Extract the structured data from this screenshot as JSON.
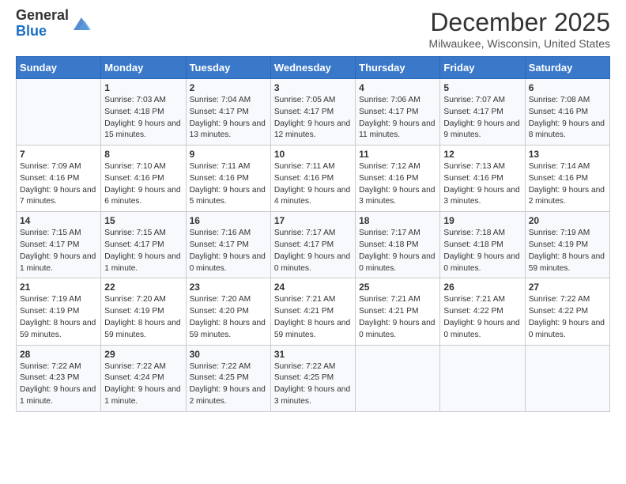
{
  "header": {
    "logo_general": "General",
    "logo_blue": "Blue",
    "month_title": "December 2025",
    "location": "Milwaukee, Wisconsin, United States"
  },
  "weekdays": [
    "Sunday",
    "Monday",
    "Tuesday",
    "Wednesday",
    "Thursday",
    "Friday",
    "Saturday"
  ],
  "weeks": [
    [
      {
        "day": "",
        "sunrise": "",
        "sunset": "",
        "daylight": ""
      },
      {
        "day": "1",
        "sunrise": "Sunrise: 7:03 AM",
        "sunset": "Sunset: 4:18 PM",
        "daylight": "Daylight: 9 hours and 15 minutes."
      },
      {
        "day": "2",
        "sunrise": "Sunrise: 7:04 AM",
        "sunset": "Sunset: 4:17 PM",
        "daylight": "Daylight: 9 hours and 13 minutes."
      },
      {
        "day": "3",
        "sunrise": "Sunrise: 7:05 AM",
        "sunset": "Sunset: 4:17 PM",
        "daylight": "Daylight: 9 hours and 12 minutes."
      },
      {
        "day": "4",
        "sunrise": "Sunrise: 7:06 AM",
        "sunset": "Sunset: 4:17 PM",
        "daylight": "Daylight: 9 hours and 11 minutes."
      },
      {
        "day": "5",
        "sunrise": "Sunrise: 7:07 AM",
        "sunset": "Sunset: 4:17 PM",
        "daylight": "Daylight: 9 hours and 9 minutes."
      },
      {
        "day": "6",
        "sunrise": "Sunrise: 7:08 AM",
        "sunset": "Sunset: 4:16 PM",
        "daylight": "Daylight: 9 hours and 8 minutes."
      }
    ],
    [
      {
        "day": "7",
        "sunrise": "Sunrise: 7:09 AM",
        "sunset": "Sunset: 4:16 PM",
        "daylight": "Daylight: 9 hours and 7 minutes."
      },
      {
        "day": "8",
        "sunrise": "Sunrise: 7:10 AM",
        "sunset": "Sunset: 4:16 PM",
        "daylight": "Daylight: 9 hours and 6 minutes."
      },
      {
        "day": "9",
        "sunrise": "Sunrise: 7:11 AM",
        "sunset": "Sunset: 4:16 PM",
        "daylight": "Daylight: 9 hours and 5 minutes."
      },
      {
        "day": "10",
        "sunrise": "Sunrise: 7:11 AM",
        "sunset": "Sunset: 4:16 PM",
        "daylight": "Daylight: 9 hours and 4 minutes."
      },
      {
        "day": "11",
        "sunrise": "Sunrise: 7:12 AM",
        "sunset": "Sunset: 4:16 PM",
        "daylight": "Daylight: 9 hours and 3 minutes."
      },
      {
        "day": "12",
        "sunrise": "Sunrise: 7:13 AM",
        "sunset": "Sunset: 4:16 PM",
        "daylight": "Daylight: 9 hours and 3 minutes."
      },
      {
        "day": "13",
        "sunrise": "Sunrise: 7:14 AM",
        "sunset": "Sunset: 4:16 PM",
        "daylight": "Daylight: 9 hours and 2 minutes."
      }
    ],
    [
      {
        "day": "14",
        "sunrise": "Sunrise: 7:15 AM",
        "sunset": "Sunset: 4:17 PM",
        "daylight": "Daylight: 9 hours and 1 minute."
      },
      {
        "day": "15",
        "sunrise": "Sunrise: 7:15 AM",
        "sunset": "Sunset: 4:17 PM",
        "daylight": "Daylight: 9 hours and 1 minute."
      },
      {
        "day": "16",
        "sunrise": "Sunrise: 7:16 AM",
        "sunset": "Sunset: 4:17 PM",
        "daylight": "Daylight: 9 hours and 0 minutes."
      },
      {
        "day": "17",
        "sunrise": "Sunrise: 7:17 AM",
        "sunset": "Sunset: 4:17 PM",
        "daylight": "Daylight: 9 hours and 0 minutes."
      },
      {
        "day": "18",
        "sunrise": "Sunrise: 7:17 AM",
        "sunset": "Sunset: 4:18 PM",
        "daylight": "Daylight: 9 hours and 0 minutes."
      },
      {
        "day": "19",
        "sunrise": "Sunrise: 7:18 AM",
        "sunset": "Sunset: 4:18 PM",
        "daylight": "Daylight: 9 hours and 0 minutes."
      },
      {
        "day": "20",
        "sunrise": "Sunrise: 7:19 AM",
        "sunset": "Sunset: 4:19 PM",
        "daylight": "Daylight: 8 hours and 59 minutes."
      }
    ],
    [
      {
        "day": "21",
        "sunrise": "Sunrise: 7:19 AM",
        "sunset": "Sunset: 4:19 PM",
        "daylight": "Daylight: 8 hours and 59 minutes."
      },
      {
        "day": "22",
        "sunrise": "Sunrise: 7:20 AM",
        "sunset": "Sunset: 4:19 PM",
        "daylight": "Daylight: 8 hours and 59 minutes."
      },
      {
        "day": "23",
        "sunrise": "Sunrise: 7:20 AM",
        "sunset": "Sunset: 4:20 PM",
        "daylight": "Daylight: 8 hours and 59 minutes."
      },
      {
        "day": "24",
        "sunrise": "Sunrise: 7:21 AM",
        "sunset": "Sunset: 4:21 PM",
        "daylight": "Daylight: 8 hours and 59 minutes."
      },
      {
        "day": "25",
        "sunrise": "Sunrise: 7:21 AM",
        "sunset": "Sunset: 4:21 PM",
        "daylight": "Daylight: 9 hours and 0 minutes."
      },
      {
        "day": "26",
        "sunrise": "Sunrise: 7:21 AM",
        "sunset": "Sunset: 4:22 PM",
        "daylight": "Daylight: 9 hours and 0 minutes."
      },
      {
        "day": "27",
        "sunrise": "Sunrise: 7:22 AM",
        "sunset": "Sunset: 4:22 PM",
        "daylight": "Daylight: 9 hours and 0 minutes."
      }
    ],
    [
      {
        "day": "28",
        "sunrise": "Sunrise: 7:22 AM",
        "sunset": "Sunset: 4:23 PM",
        "daylight": "Daylight: 9 hours and 1 minute."
      },
      {
        "day": "29",
        "sunrise": "Sunrise: 7:22 AM",
        "sunset": "Sunset: 4:24 PM",
        "daylight": "Daylight: 9 hours and 1 minute."
      },
      {
        "day": "30",
        "sunrise": "Sunrise: 7:22 AM",
        "sunset": "Sunset: 4:25 PM",
        "daylight": "Daylight: 9 hours and 2 minutes."
      },
      {
        "day": "31",
        "sunrise": "Sunrise: 7:22 AM",
        "sunset": "Sunset: 4:25 PM",
        "daylight": "Daylight: 9 hours and 3 minutes."
      },
      {
        "day": "",
        "sunrise": "",
        "sunset": "",
        "daylight": ""
      },
      {
        "day": "",
        "sunrise": "",
        "sunset": "",
        "daylight": ""
      },
      {
        "day": "",
        "sunrise": "",
        "sunset": "",
        "daylight": ""
      }
    ]
  ]
}
